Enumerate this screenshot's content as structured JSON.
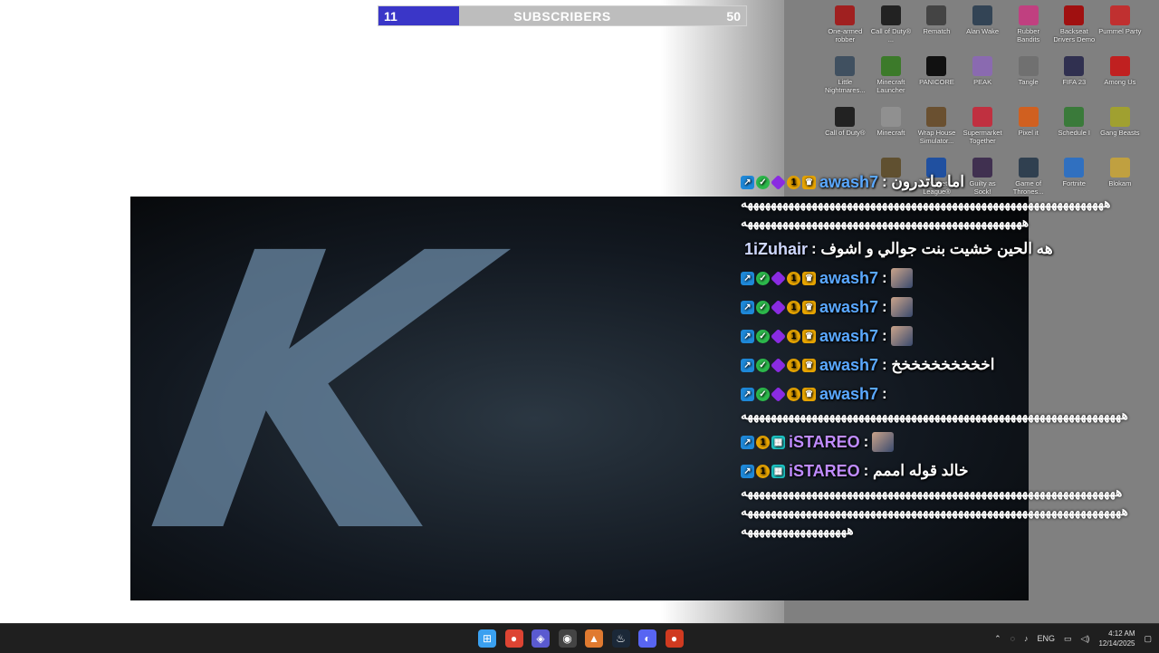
{
  "subscriber_bar": {
    "current": "11",
    "label": "SUBSCRIBERS",
    "goal": "50",
    "progress": 0.22
  },
  "desktop_icons": [
    {
      "label": "One-armed robber",
      "icon": "game-icon",
      "color": "#a02020"
    },
    {
      "label": "Call of Duty® ...",
      "icon": "cod-icon",
      "color": "#222222"
    },
    {
      "label": "Rematch",
      "icon": "game-icon",
      "color": "#444444"
    },
    {
      "label": "Alan Wake",
      "icon": "game-icon",
      "color": "#334455"
    },
    {
      "label": "Rubber Bandits",
      "icon": "game-icon",
      "color": "#c04080"
    },
    {
      "label": "Backseat Drivers Demo",
      "icon": "game-icon",
      "color": "#a01010"
    },
    {
      "label": "Pummel Party",
      "icon": "game-icon",
      "color": "#c03030"
    },
    {
      "label": "Little Nightmares...",
      "icon": "game-icon",
      "color": "#405060"
    },
    {
      "label": "Minecraft Launcher",
      "icon": "minecraft-icon",
      "color": "#3c7a2a"
    },
    {
      "label": "PANICORE",
      "icon": "game-icon",
      "color": "#111111"
    },
    {
      "label": "PEAK",
      "icon": "game-icon",
      "color": "#8a6ab0"
    },
    {
      "label": "Tangle",
      "icon": "game-icon",
      "color": "#707070"
    },
    {
      "label": "FIFA 23",
      "icon": "game-icon",
      "color": "#303050"
    },
    {
      "label": "Among Us",
      "icon": "game-icon",
      "color": "#c02020"
    },
    {
      "label": "Call of Duty®",
      "icon": "cod-icon",
      "color": "#222222"
    },
    {
      "label": "Minecraft",
      "icon": "file-icon",
      "color": "#909090"
    },
    {
      "label": "Wrap House Simulator...",
      "icon": "game-icon",
      "color": "#6a5030"
    },
    {
      "label": "Supermarket Together",
      "icon": "game-icon",
      "color": "#c03040"
    },
    {
      "label": "Pixel it",
      "icon": "game-icon",
      "color": "#d06020"
    },
    {
      "label": "Schedule I",
      "icon": "game-icon",
      "color": "#3a7a3a"
    },
    {
      "label": "Gang Beasts",
      "icon": "game-icon",
      "color": "#a0a030"
    },
    {
      "label": "",
      "icon": "blank-icon",
      "color": "#808080"
    },
    {
      "label": "",
      "icon": "game-icon",
      "color": "#605030"
    },
    {
      "label": "Rocket League®",
      "icon": "game-icon",
      "color": "#2050a0"
    },
    {
      "label": "Guilty as Sock!",
      "icon": "game-icon",
      "color": "#403050"
    },
    {
      "label": "Game of Thrones...",
      "icon": "game-icon",
      "color": "#304050"
    },
    {
      "label": "Fortnite",
      "icon": "game-icon",
      "color": "#3070c0"
    },
    {
      "label": "Blokam",
      "icon": "game-icon",
      "color": "#c0a040"
    }
  ],
  "chat": {
    "messages": [
      {
        "badges": [
          "prime",
          "verify",
          "cube",
          "one",
          "crown"
        ],
        "user": "awash7",
        "user_color": "#5aa8ff",
        "text": "اما ماتدرون :",
        "emote": false
      },
      {
        "wrap": "ههههههههههههههههههههههههههههههههههههههههههههههههههههههههههههههه"
      },
      {
        "wrap": "ههههههههههههههههههههههههههههههههههههههههههههههههه"
      },
      {
        "badges": [],
        "user": "1iZuhair",
        "user_color": "#cfd8ff",
        "text": "هه الحين خشيت بنت جوالي و اشوف :",
        "emote": false
      },
      {
        "badges": [
          "prime",
          "verify",
          "cube",
          "one",
          "crown"
        ],
        "user": "awash7",
        "user_color": "#5aa8ff",
        "text": ":",
        "emote": true
      },
      {
        "badges": [
          "prime",
          "verify",
          "cube",
          "one",
          "crown"
        ],
        "user": "awash7",
        "user_color": "#5aa8ff",
        "text": ":",
        "emote": true
      },
      {
        "badges": [
          "prime",
          "verify",
          "cube",
          "one",
          "crown"
        ],
        "user": "awash7",
        "user_color": "#5aa8ff",
        "text": ":",
        "emote": true
      },
      {
        "badges": [
          "prime",
          "verify",
          "cube",
          "one",
          "crown"
        ],
        "user": "awash7",
        "user_color": "#5aa8ff",
        "text": "اخخخخخخخخخخ :",
        "emote": false
      },
      {
        "badges": [
          "prime",
          "verify",
          "cube",
          "one",
          "crown"
        ],
        "user": "awash7",
        "user_color": "#5aa8ff",
        "text": ":",
        "emote": false
      },
      {
        "wrap": "هههههههههههههههههههههههههههههههههههههههههههههههههههههههههههههههههه"
      },
      {
        "badges": [
          "prime",
          "one",
          "gift"
        ],
        "user": "iSTAREO",
        "user_color": "#c08cff",
        "text": ":",
        "emote": true
      },
      {
        "badges": [
          "prime",
          "one",
          "gift"
        ],
        "user": "iSTAREO",
        "user_color": "#c08cff",
        "text": "خالد قوله اممم :",
        "emote": false
      },
      {
        "wrap": "ههههههههههههههههههههههههههههههههههههههههههههههههههههههههههههههههه"
      },
      {
        "wrap": "هههههههههههههههههههههههههههههههههههههههههههههههههههههههههههههههههه"
      },
      {
        "wrap": "ههههههههههههههههههه"
      }
    ]
  },
  "taskbar": {
    "apps": [
      {
        "name": "windows-start-icon",
        "glyph": "⊞",
        "color": "#3aa0f0"
      },
      {
        "name": "chrome-icon",
        "glyph": "●",
        "color": "#dd4433"
      },
      {
        "name": "app-icon",
        "glyph": "◈",
        "color": "#5a5ad0"
      },
      {
        "name": "obs-icon",
        "glyph": "◉",
        "color": "#444444"
      },
      {
        "name": "folder-icon",
        "glyph": "▲",
        "color": "#e07a30"
      },
      {
        "name": "steam-icon",
        "glyph": "♨",
        "color": "#1b2838"
      },
      {
        "name": "discord-icon",
        "glyph": "◐",
        "color": "#5865f2"
      },
      {
        "name": "ea-icon",
        "glyph": "●",
        "color": "#d03a20"
      }
    ],
    "tray_lang": "ENG",
    "time": "4:12 AM",
    "date": "12/14/2025"
  }
}
